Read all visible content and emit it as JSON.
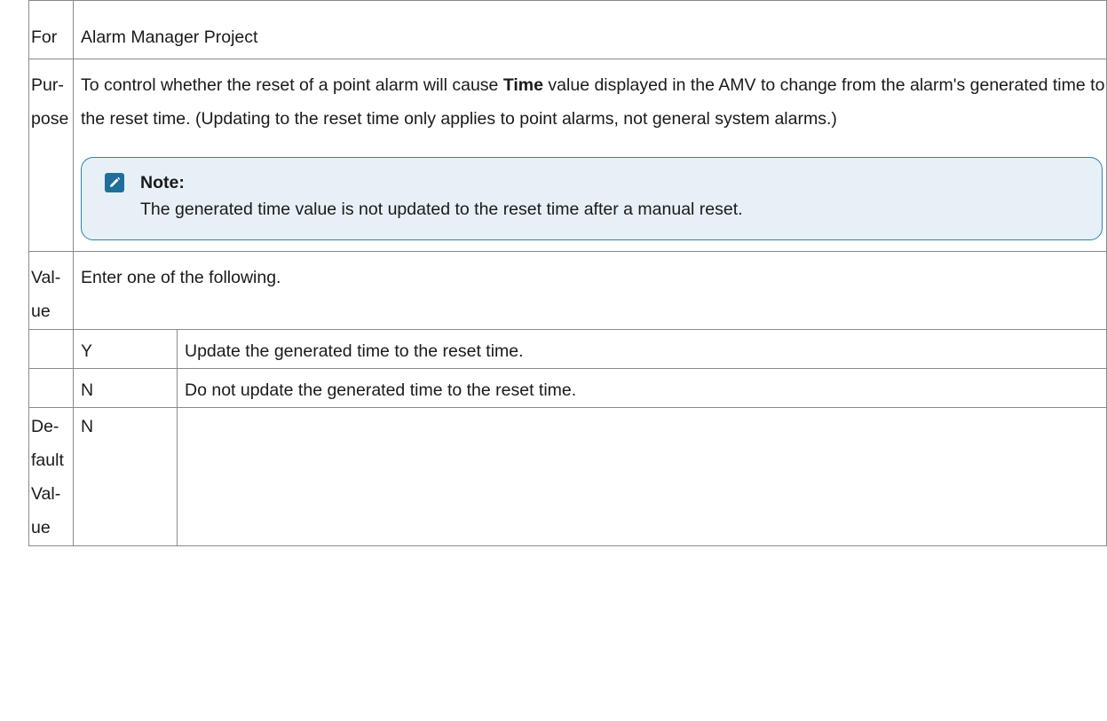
{
  "rows": {
    "for": {
      "label": "For",
      "value": "Alarm Manager Project"
    },
    "purpose": {
      "label_part1": "Pur-",
      "label_part2": "pose",
      "text_before_bold": "To control whether the reset of a point alarm will cause ",
      "bold_word": "Time",
      "text_after_bold": " value displayed in the AMV to change from the alarm's generated time to the reset time. (Updating to the reset time only applies to point alarms, not general system alarms.)",
      "note": {
        "icon": "pencil-note-icon",
        "title": "Note:",
        "body": "The generated time value is not updated to the reset time after a manual reset."
      }
    },
    "value": {
      "label_part1": "Val-",
      "label_part2": "ue",
      "text": "Enter one of the following."
    },
    "options": [
      {
        "code": "Y",
        "description": "Update the generated time to the reset time."
      },
      {
        "code": "N",
        "description": "Do not update the generated time to the reset time."
      }
    ],
    "default": {
      "label_part1": "De-",
      "label_part2": "fault",
      "label_part3": "Val-",
      "label_part4": "ue",
      "value": "N"
    }
  },
  "colors": {
    "note_border": "#2b82a8",
    "note_background": "#e7f0f6",
    "note_icon": "#1f6f9b",
    "grid_line": "#8a8a8a"
  }
}
